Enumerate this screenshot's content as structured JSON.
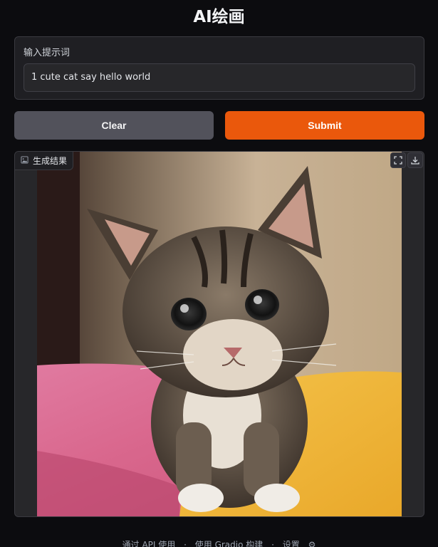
{
  "title": "AI绘画",
  "prompt": {
    "label": "输入提示词",
    "value": "1 cute cat say hello world"
  },
  "buttons": {
    "clear": "Clear",
    "submit": "Submit"
  },
  "result": {
    "label": "生成结果",
    "icons": [
      "image-icon",
      "fullscreen-icon",
      "download-icon"
    ]
  },
  "footer": {
    "api": "通过 API 使用",
    "built": "使用 Gradio 构建",
    "settings": "设置"
  },
  "colors": {
    "accent": "#ea580c",
    "background": "#0c0c0f",
    "panel": "#1f1f23"
  }
}
